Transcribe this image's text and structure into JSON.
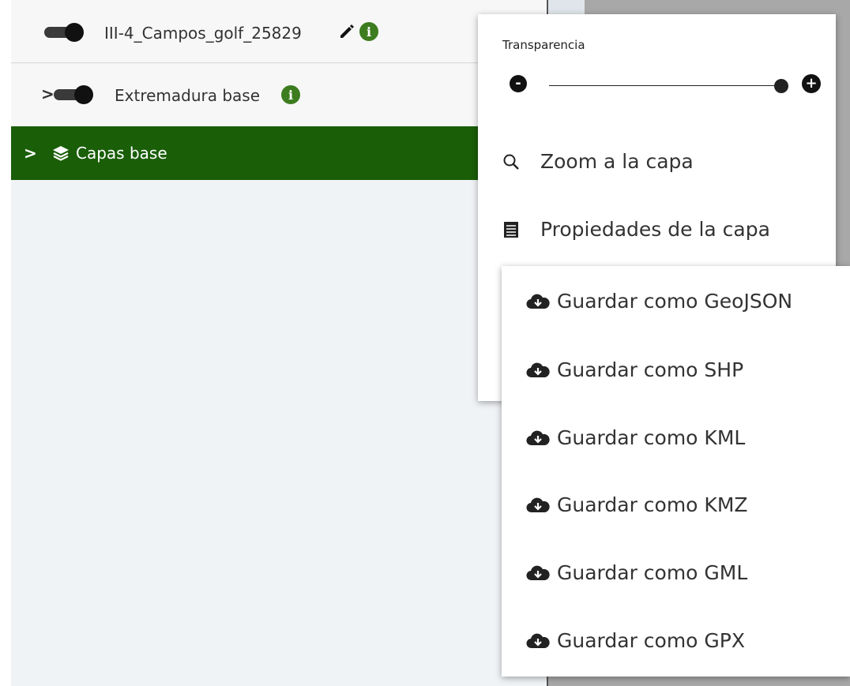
{
  "layers": {
    "campos": {
      "label": "III-4_Campos_golf_25829"
    },
    "extremadura": {
      "chevron": ">",
      "label": "Extremadura base"
    },
    "capas_base": {
      "chevron": ">",
      "label": "Capas base"
    }
  },
  "context_menu": {
    "transparency_label": "Transparencia",
    "slider_minus": "-",
    "slider_plus": "+",
    "transparency_value": 1.0,
    "zoom_label": "Zoom a la capa",
    "properties_label": "Propiedades de la capa"
  },
  "save_menu": {
    "items": [
      "Guardar como GeoJSON",
      "Guardar como SHP",
      "Guardar como KML",
      "Guardar como KMZ",
      "Guardar como GML",
      "Guardar como GPX"
    ]
  },
  "colors": {
    "accent_green": "#1a5e08",
    "info_green": "#3d7c1f"
  },
  "icons": {
    "edit": "pencil-icon",
    "info": "info-icon",
    "layers": "layers-icon",
    "zoom": "search-icon",
    "properties": "list-icon",
    "download": "cloud-download-icon"
  }
}
